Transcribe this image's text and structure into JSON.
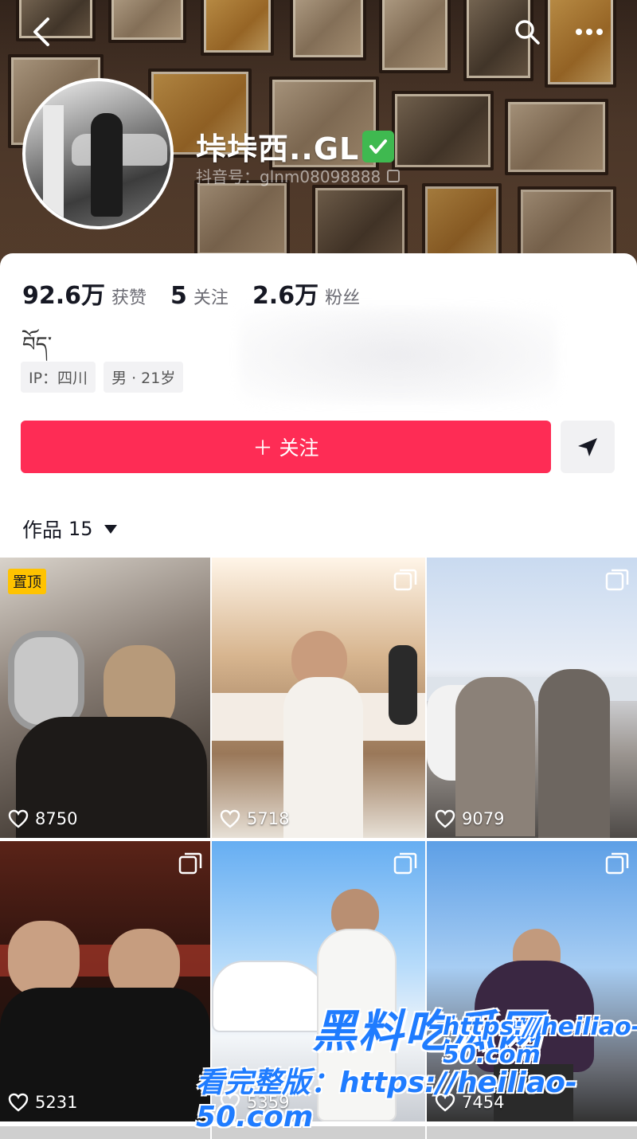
{
  "profile": {
    "nickname": "垰垰西..GL",
    "douyin_id": "抖音号：glnm08098888",
    "bio": "བོད་",
    "verified_icon": "check-badge-icon"
  },
  "stats": {
    "likes_value": "92.6万",
    "likes_label": "获赞",
    "following_value": "5",
    "following_label": "关注",
    "followers_value": "2.6万",
    "followers_label": "粉丝"
  },
  "tags": {
    "ip": "IP：四川",
    "gender_age": "男 · 21岁"
  },
  "actions": {
    "follow_label": "＋ 关注"
  },
  "works": {
    "label": "作品",
    "count": "15"
  },
  "videos": [
    {
      "likes": "8750",
      "badge": "置顶"
    },
    {
      "likes": "5718"
    },
    {
      "likes": "9079"
    },
    {
      "likes": "5231"
    },
    {
      "likes": "5359"
    },
    {
      "likes": "7454"
    }
  ],
  "watermark": {
    "brand": "黑料吃瓜网",
    "url": "https://heiliao-50.com",
    "full_label": "看完整版："
  },
  "colors": {
    "accent": "#fe2c55",
    "pin_badge": "#ffc300",
    "watermark_blue": "#1f7cff"
  }
}
